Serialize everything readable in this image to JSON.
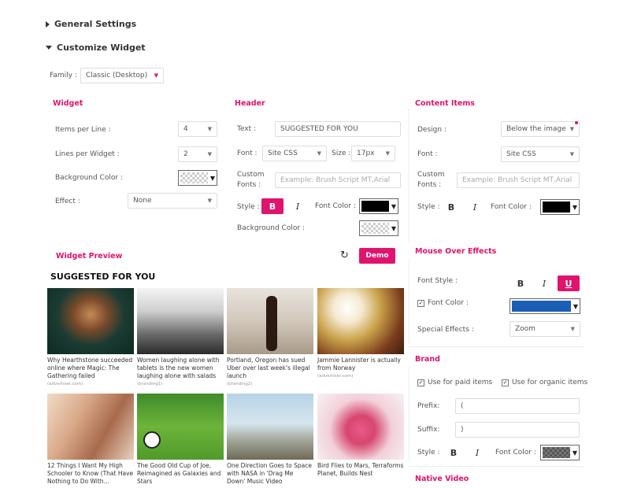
{
  "sections": {
    "general": "General Settings",
    "customize": "Customize Widget"
  },
  "family": {
    "label": "Family :",
    "value": "Classic (Desktop)"
  },
  "widget": {
    "title": "Widget",
    "items_per_line_label": "Items per Line :",
    "items_per_line": "4",
    "lines_per_widget_label": "Lines per Widget :",
    "lines_per_widget": "2",
    "bg_color_label": "Background Color :",
    "effect_label": "Effect :",
    "effect": "None"
  },
  "header": {
    "title": "Header",
    "text_label": "Text :",
    "text_value": "SUGGESTED FOR YOU",
    "font_label": "Font :",
    "font_value": "Site CSS",
    "size_label": "Size :",
    "size_value": "17px",
    "custom_fonts_label_1": "Custom",
    "custom_fonts_label_2": "Fonts :",
    "custom_fonts_placeholder": "Example: Brush Script MT,Arial",
    "style_label": "Style :",
    "bold": "B",
    "italic": "I",
    "font_color_label": "Font Color :",
    "bg_color_label": "Background Color :"
  },
  "content_items": {
    "title": "Content Items",
    "design_label": "Design :",
    "design_value": "Below the image",
    "font_label": "Font :",
    "font_value": "Site CSS",
    "custom_fonts_label_1": "Custom",
    "custom_fonts_label_2": "Fonts :",
    "custom_fonts_placeholder": "Example: Brush Script MT,Arial",
    "style_label": "Style :",
    "bold": "B",
    "italic": "I",
    "font_color_label": "Font Color :"
  },
  "preview": {
    "title": "Widget Preview",
    "demo_button": "Demo",
    "heading": "SUGGESTED FOR YOU",
    "cards": [
      {
        "title": "Why Hearthstone succeeded online where Magic: The Gathering failed",
        "source": "(advertiser.com)"
      },
      {
        "title": "Women laughing alone with tablets is the new women laughing alone with salads",
        "source": "(branding1)"
      },
      {
        "title": "Portland, Oregon has sued Uber over last week's illegal launch",
        "source": "(branding2)"
      },
      {
        "title": "Jammie Lannister is actually from Norway",
        "source": "(advertiser.com)"
      },
      {
        "title": "12 Things I Want My High Schooler to Know (That Have Nothing to Do With…",
        "source": ""
      },
      {
        "title": "The Good Old Cup of Joe, Reimagined as Galaxies and Stars",
        "source": ""
      },
      {
        "title": "One Direction Goes to Space with NASA in 'Drag Me Down' Music Video",
        "source": ""
      },
      {
        "title": "Bird Flies to Mars, Terraforms Planet, Builds Nest",
        "source": ""
      }
    ]
  },
  "mouse_over": {
    "title": "Mouse Over Effects",
    "font_style_label": "Font Style :",
    "bold": "B",
    "italic": "I",
    "underline": "U",
    "font_color_label": "Font Color :",
    "special_effects_label": "Special Effects :",
    "special_effects_value": "Zoom"
  },
  "brand": {
    "title": "Brand",
    "paid_label": "Use for paid items",
    "organic_label": "Use for organic items",
    "prefix_label": "Prefix:",
    "prefix_value": "(",
    "suffix_label": "Suffix:",
    "suffix_value": ")",
    "style_label": "Style :",
    "bold": "B",
    "italic": "I",
    "font_color_label": "Font Color :"
  },
  "native_video": {
    "title": "Native Video"
  },
  "colors": {
    "accent": "#e0136d",
    "blue_swatch": "#1a5fb4",
    "black_swatch": "#000000"
  }
}
